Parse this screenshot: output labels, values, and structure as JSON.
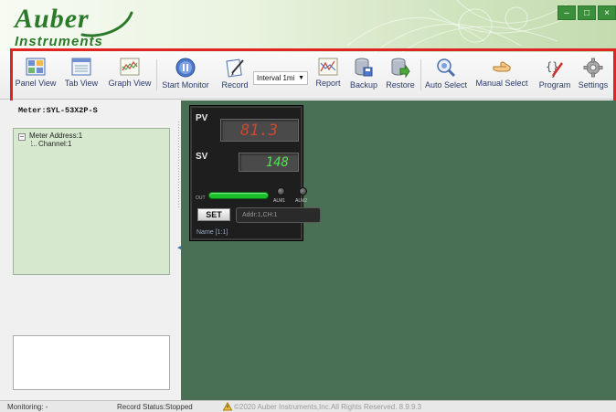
{
  "header": {
    "logo_main": "Auber",
    "logo_sub": "Instruments",
    "window_buttons": [
      "–",
      "□",
      "×"
    ]
  },
  "toolbar": {
    "buttons": [
      {
        "label": "Panel View",
        "icon": "panel-view-icon"
      },
      {
        "label": "Tab View",
        "icon": "tab-view-icon"
      },
      {
        "label": "Graph View",
        "icon": "graph-view-icon"
      },
      {
        "label": "Start Monitor",
        "icon": "start-monitor-icon"
      },
      {
        "label": "Record",
        "icon": "record-icon"
      },
      {
        "label": "Report",
        "icon": "report-icon"
      },
      {
        "label": "Backup",
        "icon": "backup-icon"
      },
      {
        "label": "Restore",
        "icon": "restore-icon"
      },
      {
        "label": "Auto Select",
        "icon": "auto-select-icon"
      },
      {
        "label": "Manual Select",
        "icon": "manual-select-icon"
      },
      {
        "label": "Program",
        "icon": "program-icon"
      },
      {
        "label": "Settings",
        "icon": "settings-icon"
      }
    ],
    "interval_value": "Interval 1mi"
  },
  "left_panel": {
    "meter_title": "Meter:SYL-53X2P-S",
    "tree": {
      "root": "Meter Address:1",
      "child": "Channel:1",
      "toggle": "−"
    }
  },
  "meter": {
    "pv_label": "PV",
    "pv_value": "81.3",
    "sv_label": "SV",
    "sv_value": "148",
    "out_label": "OUT",
    "alm1": "ALM1",
    "alm2": "ALM2",
    "set_label": "SET",
    "addr": "Addr:1,CH:1",
    "name": "Name [1:1]"
  },
  "status": {
    "monitoring": "Monitoring: -",
    "record_status": "Record Status:Stopped",
    "copyright": "©2020 Auber Instruments,Inc.All Rights Reserved. 8.9.9.3"
  },
  "colors": {
    "accent_green": "#2b7a2b",
    "main_bg": "#496f54",
    "highlight_red": "#e02424",
    "pv_red": "#c84a2c",
    "sv_green": "#4fe04f"
  }
}
